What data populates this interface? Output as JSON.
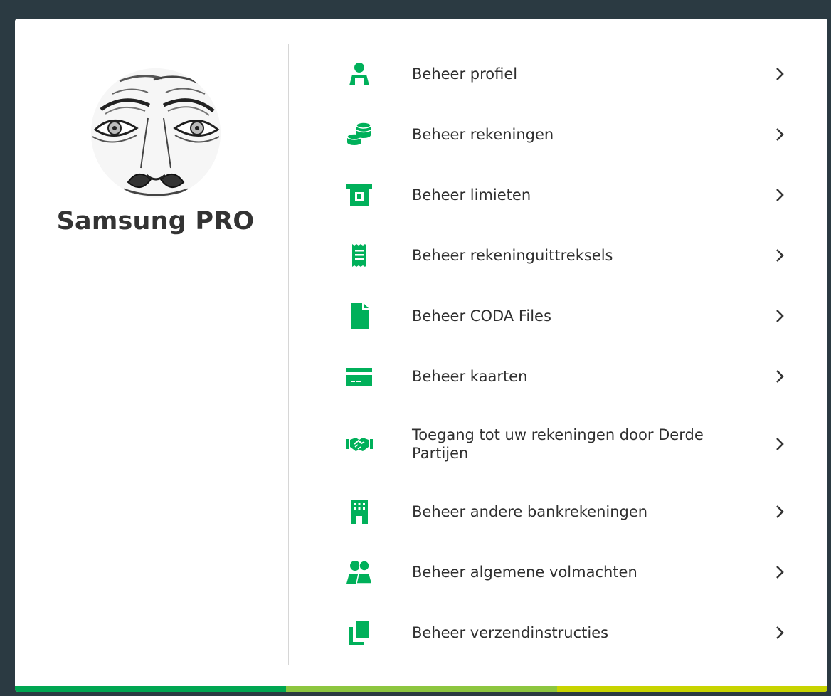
{
  "colors": {
    "page_background": "#2b3a42",
    "card_background": "#ffffff",
    "icon_green": "#00b05a",
    "text": "#2f2f2f",
    "accent_bar": [
      "#00a651",
      "#8dc63f",
      "#c8d400"
    ]
  },
  "profile": {
    "name": "Samsung PRO",
    "avatar": "sketch-face-avatar"
  },
  "menu": {
    "items": [
      {
        "label": "Beheer profiel",
        "icon": "person-icon"
      },
      {
        "label": "Beheer rekeningen",
        "icon": "coins-icon"
      },
      {
        "label": "Beheer limieten",
        "icon": "atm-icon"
      },
      {
        "label": "Beheer rekeninguittreksels",
        "icon": "receipt-icon"
      },
      {
        "label": "Beheer CODA Files",
        "icon": "file-icon"
      },
      {
        "label": "Beheer kaarten",
        "icon": "card-icon"
      },
      {
        "label": "Toegang tot uw rekeningen door Derde Partijen",
        "icon": "handshake-icon"
      },
      {
        "label": "Beheer andere bankrekeningen",
        "icon": "building-icon"
      },
      {
        "label": "Beheer algemene volmachten",
        "icon": "people-icon"
      },
      {
        "label": "Beheer verzendinstructies",
        "icon": "copy-icon"
      }
    ],
    "chevron_icon": "chevron-right-icon"
  }
}
